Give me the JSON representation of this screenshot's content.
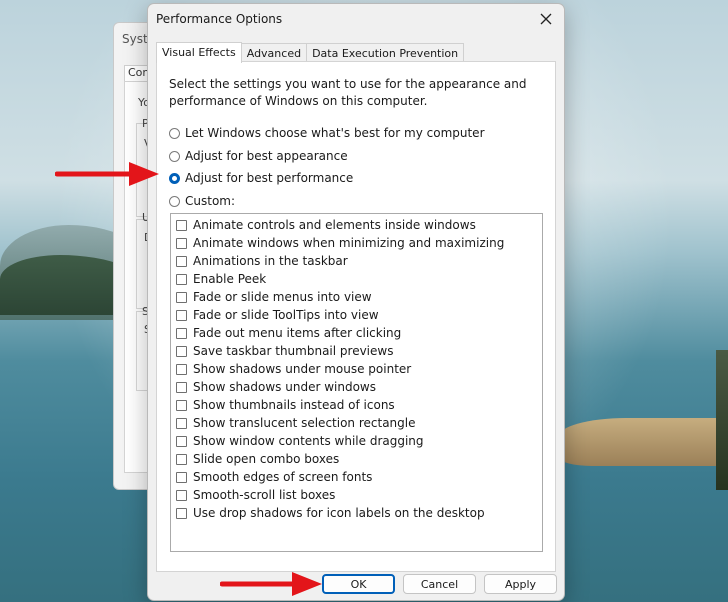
{
  "background_window": {
    "title_fragment": "Syste",
    "tab_fragment": "Com",
    "fragments": [
      "Yo",
      "P",
      "V",
      "U",
      "D",
      "S",
      "S"
    ]
  },
  "dialog": {
    "title": "Performance Options",
    "tabs": [
      {
        "label": "Visual Effects",
        "active": true
      },
      {
        "label": "Advanced",
        "active": false
      },
      {
        "label": "Data Execution Prevention",
        "active": false
      }
    ],
    "intro_text": "Select the settings you want to use for the appearance and performance of Windows on this computer.",
    "radio_options": [
      {
        "label": "Let Windows choose what's best for my computer",
        "checked": false
      },
      {
        "label": "Adjust for best appearance",
        "checked": false
      },
      {
        "label": "Adjust for best performance",
        "checked": true
      },
      {
        "label": "Custom:",
        "checked": false
      }
    ],
    "effects": [
      {
        "label": "Animate controls and elements inside windows",
        "checked": false
      },
      {
        "label": "Animate windows when minimizing and maximizing",
        "checked": false
      },
      {
        "label": "Animations in the taskbar",
        "checked": false
      },
      {
        "label": "Enable Peek",
        "checked": false
      },
      {
        "label": "Fade or slide menus into view",
        "checked": false
      },
      {
        "label": "Fade or slide ToolTips into view",
        "checked": false
      },
      {
        "label": "Fade out menu items after clicking",
        "checked": false
      },
      {
        "label": "Save taskbar thumbnail previews",
        "checked": false
      },
      {
        "label": "Show shadows under mouse pointer",
        "checked": false
      },
      {
        "label": "Show shadows under windows",
        "checked": false
      },
      {
        "label": "Show thumbnails instead of icons",
        "checked": false
      },
      {
        "label": "Show translucent selection rectangle",
        "checked": false
      },
      {
        "label": "Show window contents while dragging",
        "checked": false
      },
      {
        "label": "Slide open combo boxes",
        "checked": false
      },
      {
        "label": "Smooth edges of screen fonts",
        "checked": false
      },
      {
        "label": "Smooth-scroll list boxes",
        "checked": false
      },
      {
        "label": "Use drop shadows for icon labels on the desktop",
        "checked": false
      }
    ],
    "buttons": {
      "ok": "OK",
      "cancel": "Cancel",
      "apply": "Apply"
    },
    "close_icon": "close-icon"
  },
  "colors": {
    "accent": "#005fb8",
    "annotation_arrow": "#e3151a"
  }
}
